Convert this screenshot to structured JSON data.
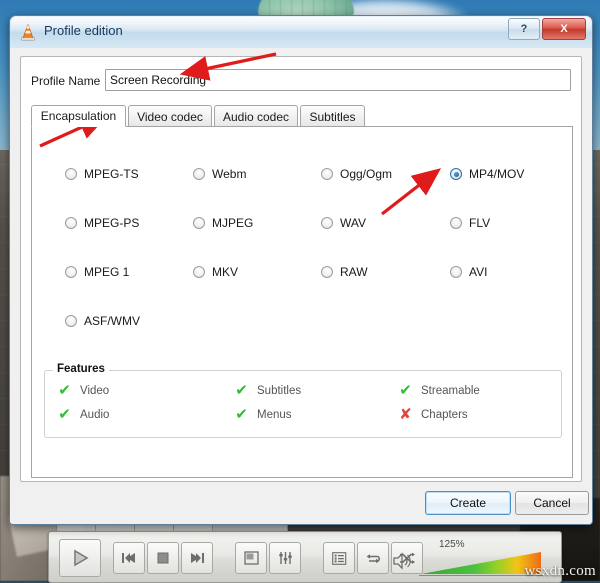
{
  "window": {
    "title": "Profile edition",
    "app_icon": "vlc-cone-icon",
    "help_label": "?",
    "close_label": "X"
  },
  "profile_name": {
    "label": "Profile Name",
    "value": "Screen Recording",
    "placeholder": ""
  },
  "tabs": [
    {
      "label": "Encapsulation",
      "active": true
    },
    {
      "label": "Video codec",
      "active": false
    },
    {
      "label": "Audio codec",
      "active": false
    },
    {
      "label": "Subtitles",
      "active": false
    }
  ],
  "encapsulation": {
    "options": [
      {
        "label": "MPEG-TS",
        "selected": false
      },
      {
        "label": "Webm",
        "selected": false
      },
      {
        "label": "Ogg/Ogm",
        "selected": false
      },
      {
        "label": "MP4/MOV",
        "selected": true
      },
      {
        "label": "MPEG-PS",
        "selected": false
      },
      {
        "label": "MJPEG",
        "selected": false
      },
      {
        "label": "WAV",
        "selected": false
      },
      {
        "label": "FLV",
        "selected": false
      },
      {
        "label": "MPEG 1",
        "selected": false
      },
      {
        "label": "MKV",
        "selected": false
      },
      {
        "label": "RAW",
        "selected": false
      },
      {
        "label": "AVI",
        "selected": false
      },
      {
        "label": "ASF/WMV",
        "selected": false
      }
    ]
  },
  "features": {
    "legend": "Features",
    "items": [
      {
        "label": "Video",
        "mark": "✔",
        "supported": true
      },
      {
        "label": "Subtitles",
        "mark": "✔",
        "supported": true
      },
      {
        "label": "Streamable",
        "mark": "✔",
        "supported": true
      },
      {
        "label": "Audio",
        "mark": "✔",
        "supported": true
      },
      {
        "label": "Menus",
        "mark": "✔",
        "supported": true
      },
      {
        "label": "Chapters",
        "mark": "✘",
        "supported": false
      }
    ]
  },
  "buttons": {
    "create": "Create",
    "cancel": "Cancel"
  },
  "player": {
    "volume_percent": "125%",
    "watermark": "wsxdn.com",
    "controls": [
      "play-icon",
      "previous-icon",
      "stop-icon",
      "next-icon",
      "fullscreen-icon",
      "equalizer-icon",
      "playlist-icon",
      "loop-icon",
      "shuffle-icon",
      "volume-icon"
    ]
  },
  "colors": {
    "accent": "#2f6f9e",
    "ok": "#2fbf2f",
    "no": "#e0443a",
    "annotation": "#e01b1b",
    "close": "#c33a2c"
  }
}
